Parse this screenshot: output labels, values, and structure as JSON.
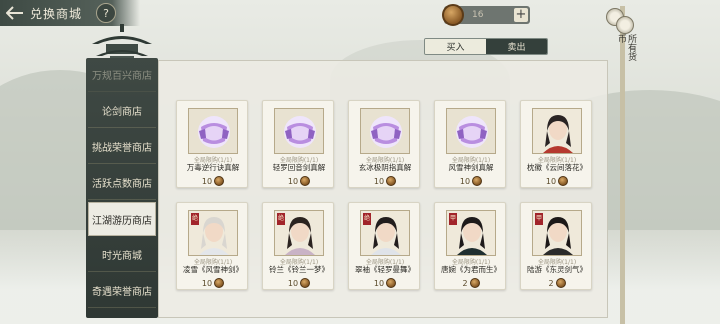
{
  "header": {
    "back_icon": "back-arrow-icon",
    "title": "兑换商城",
    "help_label": "?"
  },
  "currency": {
    "icon": "coin-icon",
    "amount": "16",
    "plus_label": "+"
  },
  "side_scroll": {
    "label": "所有货币"
  },
  "tabs": [
    {
      "label": "买入",
      "selected": true
    },
    {
      "label": "卖出",
      "selected": false
    }
  ],
  "nav": {
    "items": [
      {
        "label": "万规百兴商店",
        "active": false,
        "faded": true
      },
      {
        "label": "论剑商店",
        "active": false
      },
      {
        "label": "挑战荣誉商店",
        "active": false
      },
      {
        "label": "活跃点数商店",
        "active": false
      },
      {
        "label": "江湖游历商店",
        "active": true
      },
      {
        "label": "时光商城",
        "active": false
      },
      {
        "label": "奇遇荣誉商店",
        "active": false
      }
    ]
  },
  "items": [
    {
      "name": "万毒逆行诀真解",
      "limit": "全局限购(1/1)",
      "price": "10",
      "kind": "book"
    },
    {
      "name": "轻罗回音剑真解",
      "limit": "全局限购(1/1)",
      "price": "10",
      "kind": "book"
    },
    {
      "name": "玄冰极阴指真解",
      "limit": "全局限购(1/1)",
      "price": "10",
      "kind": "book"
    },
    {
      "name": "风雪神剑真解",
      "limit": "全局限购(1/1)",
      "price": "10",
      "kind": "book"
    },
    {
      "name": "枕徽《云间落花》",
      "limit": "全局限购(1/1)",
      "price": "10",
      "kind": "portrait",
      "hair": "#2a2424",
      "robe": "#b5392f",
      "badge": ""
    },
    {
      "name": "凌雪《风雪神剑》",
      "limit": "全局限购(1/1)",
      "price": "10",
      "kind": "portrait",
      "hair": "#d9d6d0",
      "robe": "#e3e6ea",
      "badge": "绝"
    },
    {
      "name": "铃兰《铃兰一梦》",
      "limit": "全局限购(1/1)",
      "price": "10",
      "kind": "portrait",
      "hair": "#2b2320",
      "robe": "#c9b3c6",
      "badge": "绝"
    },
    {
      "name": "翠袖《轻罗曼舞》",
      "limit": "全局限购(1/1)",
      "price": "10",
      "kind": "portrait",
      "hair": "#221d1d",
      "robe": "#dfe3e9",
      "badge": "绝"
    },
    {
      "name": "唐婉《为君而生》",
      "limit": "全局限购(1/1)",
      "price": "2",
      "kind": "portrait",
      "hair": "#1e1a1a",
      "robe": "#1f2f30",
      "badge": "甲"
    },
    {
      "name": "陆游《东灵剑气》",
      "limit": "全局限购(1/1)",
      "price": "2",
      "kind": "portrait",
      "hair": "#1c1818",
      "robe": "#2b2b2b",
      "badge": "甲"
    }
  ]
}
